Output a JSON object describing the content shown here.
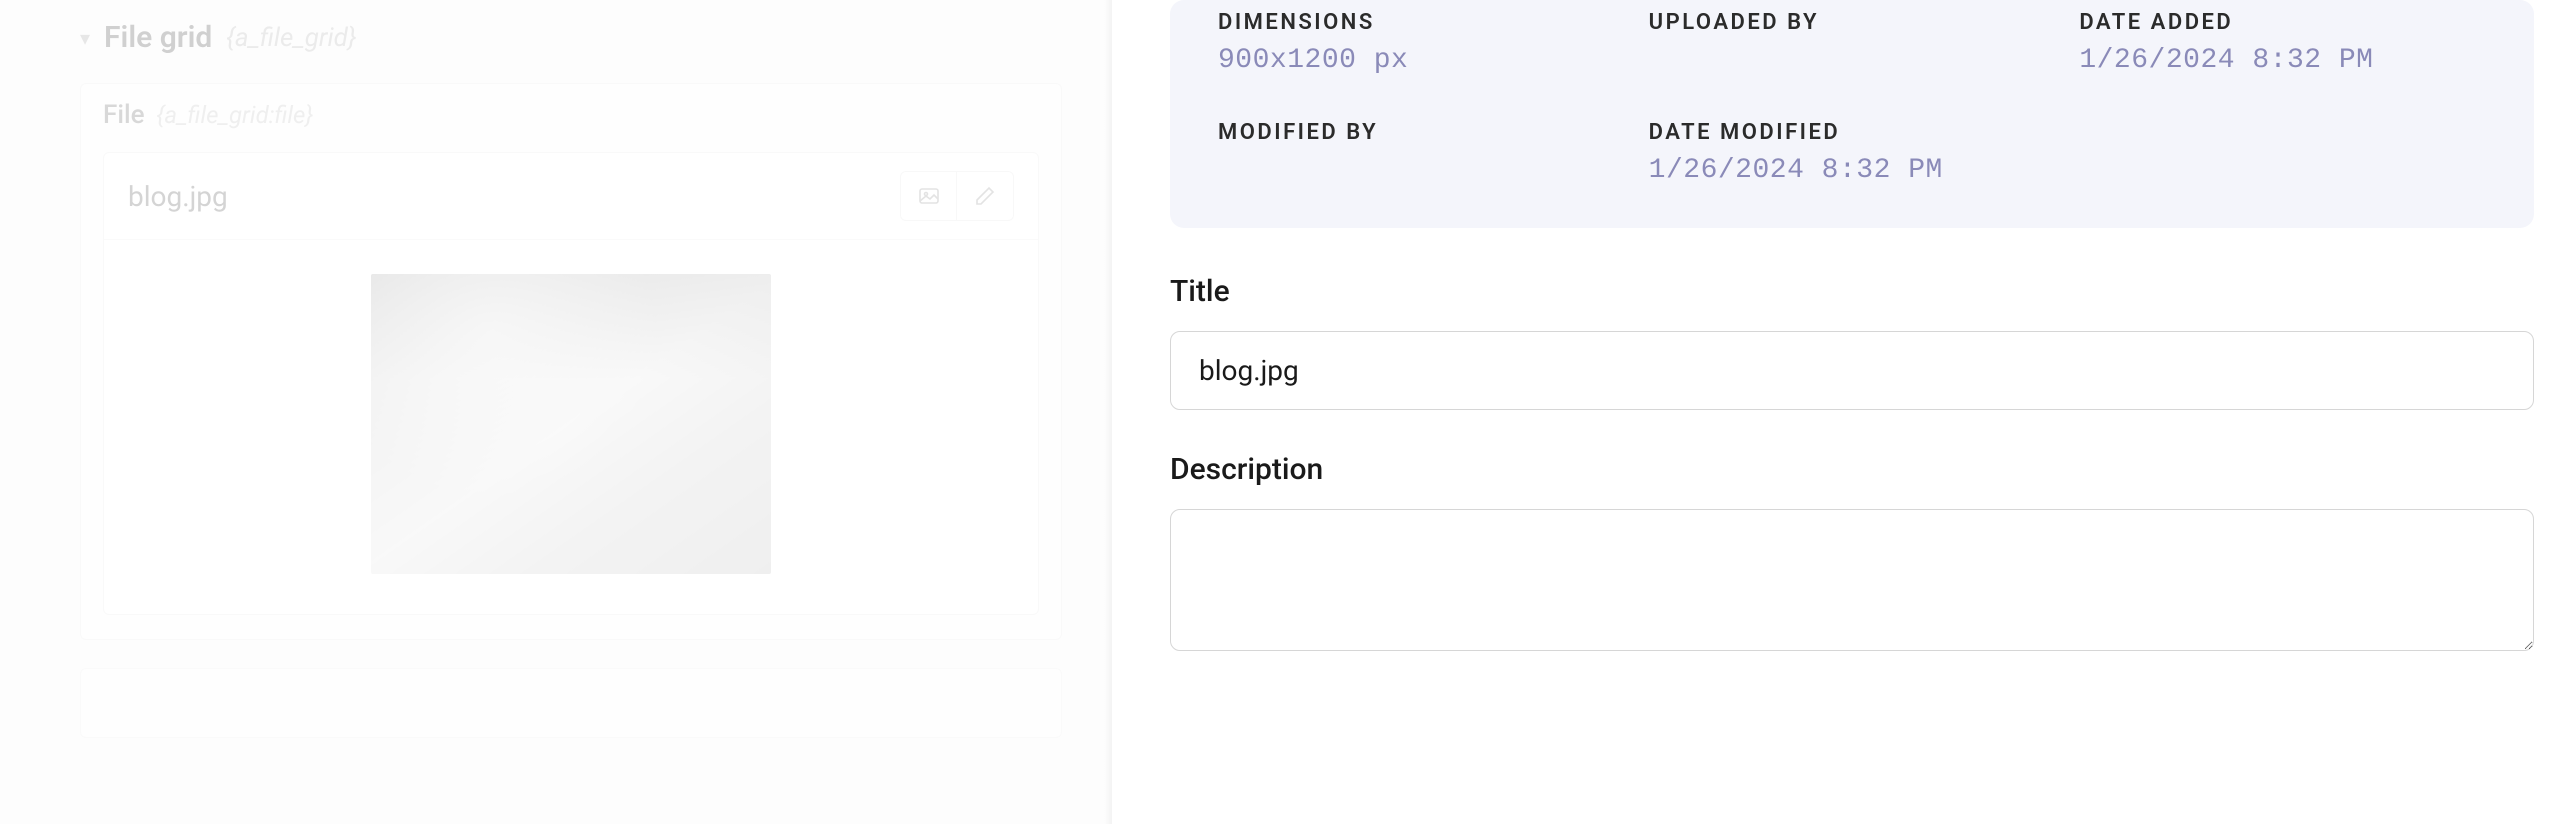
{
  "left": {
    "grid_title": "File grid",
    "grid_slug": "{a_file_grid}",
    "file_label": "File",
    "file_slug": "{a_file_grid:file}",
    "file_name": "blog.jpg"
  },
  "meta": {
    "dimensions_label": "DIMENSIONS",
    "dimensions_value": "900x1200 px",
    "uploaded_by_label": "UPLOADED BY",
    "uploaded_by_value": "",
    "date_added_label": "DATE ADDED",
    "date_added_value": "1/26/2024 8:32 PM",
    "modified_by_label": "MODIFIED BY",
    "modified_by_value": "",
    "date_modified_label": "DATE MODIFIED",
    "date_modified_value": "1/26/2024 8:32 PM"
  },
  "form": {
    "title_label": "Title",
    "title_value": "blog.jpg",
    "description_label": "Description",
    "description_value": ""
  }
}
